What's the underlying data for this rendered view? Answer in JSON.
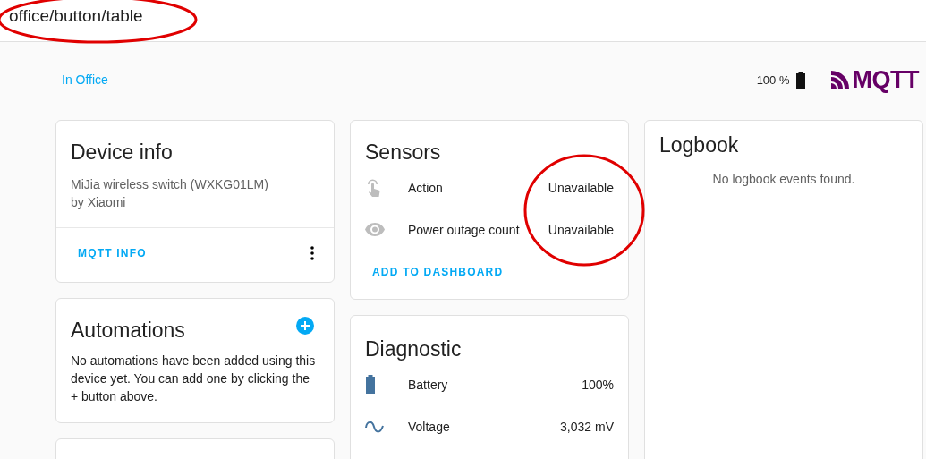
{
  "header": {
    "title": "office/button/table"
  },
  "area_link": "In Office",
  "battery": {
    "reading": "100 %"
  },
  "logo": {
    "text": "MQTT"
  },
  "device_info": {
    "title": "Device info",
    "model": "MiJia wireless switch (WXKG01LM)",
    "manufacturer": "by Xiaomi",
    "action": "MQTT INFO"
  },
  "automations": {
    "title": "Automations",
    "text": "No automations have been added using this device yet. You can add one by clicking the + button above."
  },
  "sensors": {
    "title": "Sensors",
    "entities": [
      {
        "kind": "touch",
        "available": false,
        "name": "Action",
        "value": "Unavailable"
      },
      {
        "kind": "eye",
        "available": false,
        "name": "Power outage count",
        "value": "Unavailable"
      }
    ],
    "action": "ADD TO DASHBOARD"
  },
  "diagnostic": {
    "title": "Diagnostic",
    "entities": [
      {
        "kind": "battery",
        "available": true,
        "name": "Battery",
        "value": "100%"
      },
      {
        "kind": "wave",
        "available": true,
        "name": "Voltage",
        "value": "3,032 mV"
      }
    ]
  },
  "logbook": {
    "title": "Logbook",
    "empty_text": "No logbook events found."
  }
}
